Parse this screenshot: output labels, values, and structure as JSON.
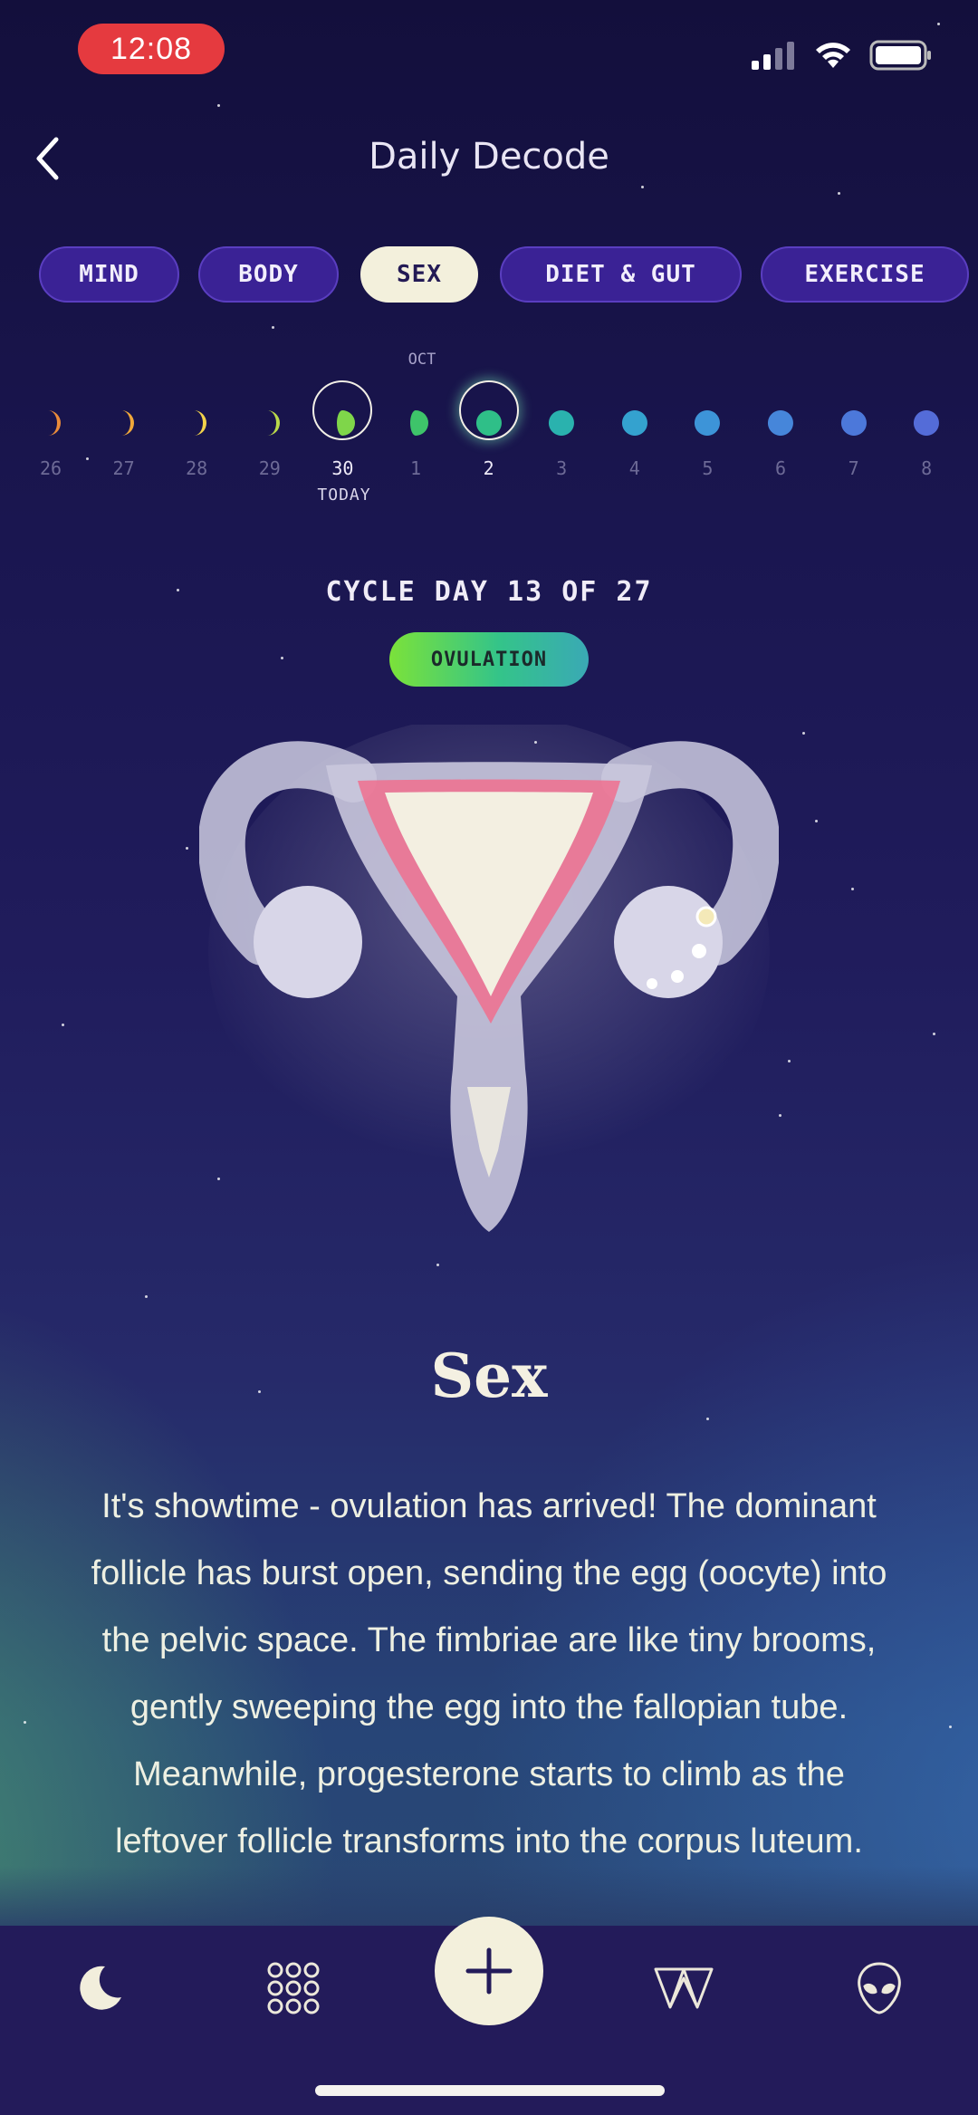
{
  "status_bar": {
    "time": "12:08"
  },
  "header": {
    "title": "Daily Decode"
  },
  "tabs": [
    {
      "label": "MIND",
      "active": false
    },
    {
      "label": "BODY",
      "active": false
    },
    {
      "label": "SEX",
      "active": true
    },
    {
      "label": "DIET & GUT",
      "active": false
    },
    {
      "label": "EXERCISE",
      "active": false
    }
  ],
  "calendar": {
    "month_label": "OCT",
    "today_label": "TODAY",
    "days": [
      {
        "num": "26",
        "phase_color": "#e98b3a",
        "shape": "crescent"
      },
      {
        "num": "27",
        "phase_color": "#f0a83a",
        "shape": "crescent"
      },
      {
        "num": "28",
        "phase_color": "#f2d24a",
        "shape": "crescent"
      },
      {
        "num": "29",
        "phase_color": "#b9d84a",
        "shape": "crescent"
      },
      {
        "num": "30",
        "phase_color": "#7fd64a",
        "shape": "half",
        "today": true
      },
      {
        "num": "1",
        "phase_color": "#3ec46a",
        "shape": "half"
      },
      {
        "num": "2",
        "phase_color": "#2fbf88",
        "shape": "full",
        "selected": true
      },
      {
        "num": "3",
        "phase_color": "#2ab2ae",
        "shape": "full"
      },
      {
        "num": "4",
        "phase_color": "#34a2cf",
        "shape": "full"
      },
      {
        "num": "5",
        "phase_color": "#3d94d8",
        "shape": "full"
      },
      {
        "num": "6",
        "phase_color": "#4686da",
        "shape": "full"
      },
      {
        "num": "7",
        "phase_color": "#4c78da",
        "shape": "full"
      },
      {
        "num": "8",
        "phase_color": "#546cd8",
        "shape": "full"
      }
    ]
  },
  "cycle": {
    "label": "CYCLE DAY 13 OF 27",
    "phase": "OVULATION"
  },
  "content": {
    "title": "Sex",
    "body": "It's showtime - ovulation has arrived! The dominant follicle has burst open, sending the egg (oocyte) into the pelvic space. The fimbriae are like tiny brooms, gently sweeping the egg into the fallopian tube. Meanwhile, progesterone starts to climb as the leftover follicle transforms into the corpus luteum."
  },
  "bottom_nav": [
    {
      "icon": "moon-icon"
    },
    {
      "icon": "grid-icon"
    },
    {
      "icon": "plus-icon"
    },
    {
      "icon": "w-logo-icon"
    },
    {
      "icon": "alien-icon"
    }
  ]
}
